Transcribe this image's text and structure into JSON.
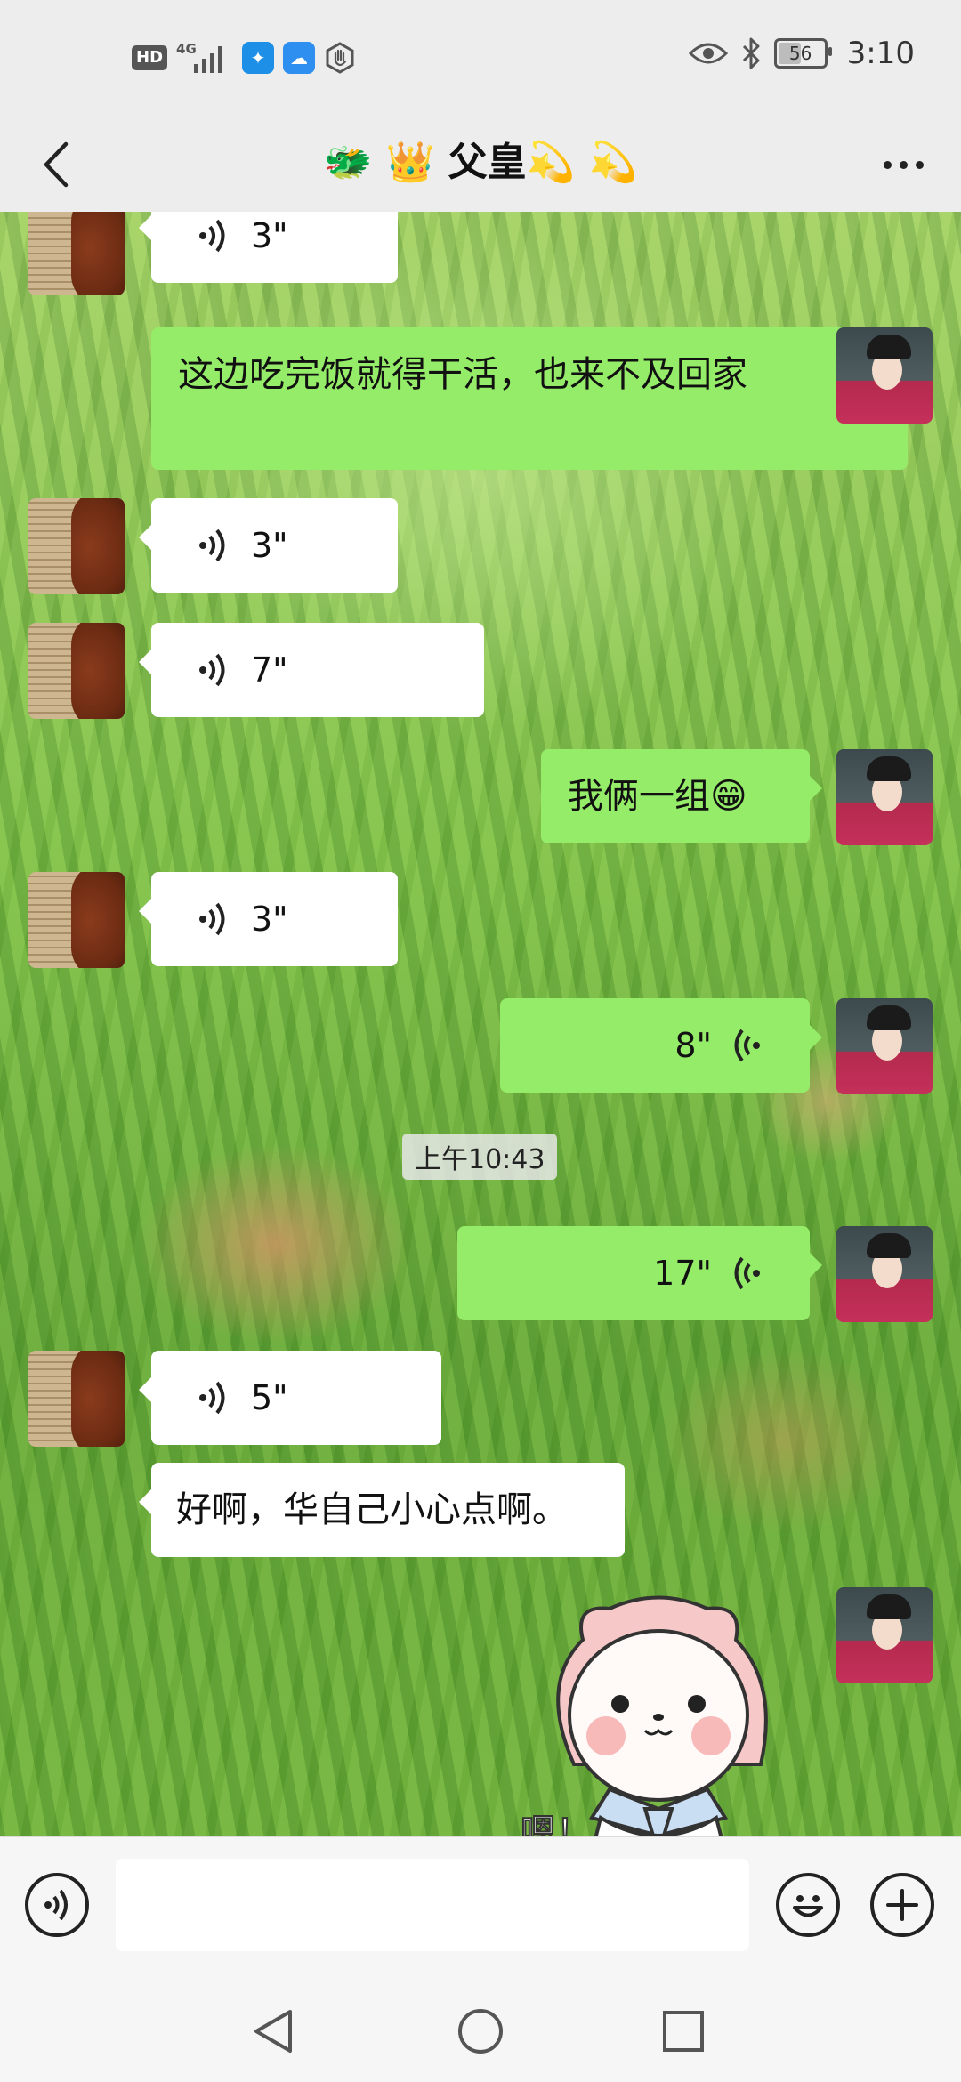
{
  "status_bar": {
    "hd": "HD",
    "network": "4G",
    "battery": "56",
    "battery_level": 0.56,
    "time": "3:10",
    "app_icon_colors": [
      "#1e8fe6",
      "#2f8ff0"
    ]
  },
  "header": {
    "title": "🐲 👑 父皇💫 💫"
  },
  "messages": [
    {
      "side": "left",
      "type": "voice",
      "duration": "3\""
    },
    {
      "side": "right",
      "type": "text",
      "text": "这边吃完饭就得干活，也来不及回家"
    },
    {
      "side": "left",
      "type": "voice",
      "duration": "3\""
    },
    {
      "side": "left",
      "type": "voice",
      "duration": "7\""
    },
    {
      "side": "right",
      "type": "text",
      "text": "我俩一组😁"
    },
    {
      "side": "left",
      "type": "voice",
      "duration": "3\""
    },
    {
      "side": "right",
      "type": "voice",
      "duration": "8\""
    },
    {
      "side": "center",
      "type": "timestamp",
      "text": "上午10:43"
    },
    {
      "side": "right",
      "type": "voice",
      "duration": "17\""
    },
    {
      "side": "left",
      "type": "voice",
      "duration": "5\""
    },
    {
      "side": "left",
      "type": "text",
      "text": "好啊，华自己小心点啊。"
    },
    {
      "side": "right",
      "type": "sticker",
      "text": "嗯！"
    }
  ],
  "input_bar": {
    "placeholder": ""
  },
  "colors": {
    "my_bubble": "#95ec69",
    "their_bubble": "#ffffff",
    "bar_bg": "#ededed"
  }
}
